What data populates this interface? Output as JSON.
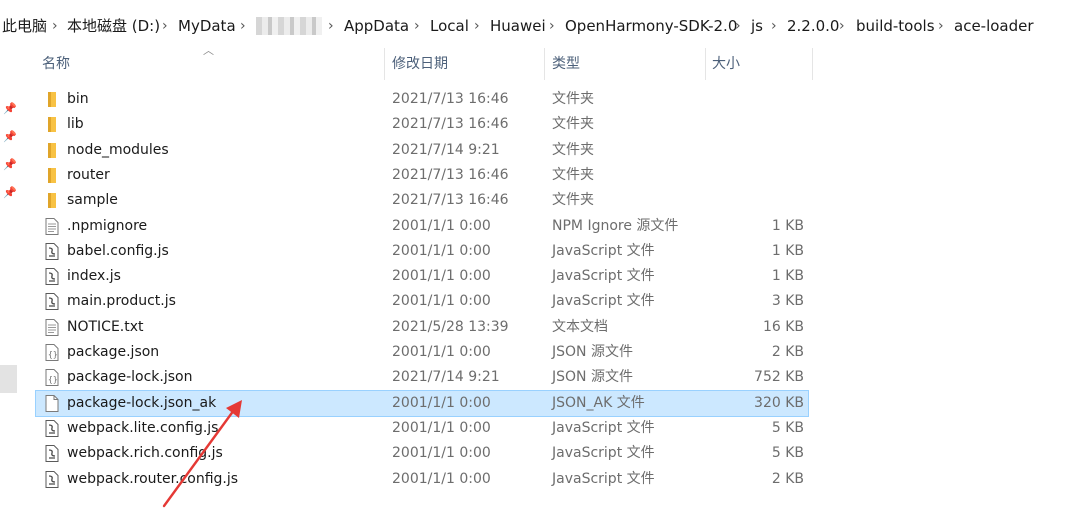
{
  "breadcrumb": {
    "items": [
      "此电脑",
      "本地磁盘 (D:)",
      "MyData",
      "AppData",
      "Local",
      "Huawei",
      "OpenHarmony-SDK-2.0",
      "js",
      "2.2.0.0",
      "build-tools",
      "ace-loader"
    ],
    "separator": "›"
  },
  "columns": {
    "name": "名称",
    "date": "修改日期",
    "type": "类型",
    "size": "大小"
  },
  "files": [
    {
      "name": "bin",
      "date": "2021/7/13 16:46",
      "type": "文件夹",
      "size": "",
      "icon": "folder-icon"
    },
    {
      "name": "lib",
      "date": "2021/7/13 16:46",
      "type": "文件夹",
      "size": "",
      "icon": "folder-icon"
    },
    {
      "name": "node_modules",
      "date": "2021/7/14 9:21",
      "type": "文件夹",
      "size": "",
      "icon": "folder-icon"
    },
    {
      "name": "router",
      "date": "2021/7/13 16:46",
      "type": "文件夹",
      "size": "",
      "icon": "folder-icon"
    },
    {
      "name": "sample",
      "date": "2021/7/13 16:46",
      "type": "文件夹",
      "size": "",
      "icon": "folder-icon"
    },
    {
      "name": ".npmignore",
      "date": "2001/1/1 0:00",
      "type": "NPM Ignore 源文件",
      "size": "1 KB",
      "icon": "text-file-icon"
    },
    {
      "name": "babel.config.js",
      "date": "2001/1/1 0:00",
      "type": "JavaScript 文件",
      "size": "1 KB",
      "icon": "script-file-icon"
    },
    {
      "name": "index.js",
      "date": "2001/1/1 0:00",
      "type": "JavaScript 文件",
      "size": "1 KB",
      "icon": "script-file-icon"
    },
    {
      "name": "main.product.js",
      "date": "2001/1/1 0:00",
      "type": "JavaScript 文件",
      "size": "3 KB",
      "icon": "script-file-icon"
    },
    {
      "name": "NOTICE.txt",
      "date": "2021/5/28 13:39",
      "type": "文本文档",
      "size": "16 KB",
      "icon": "text-file-icon"
    },
    {
      "name": "package.json",
      "date": "2001/1/1 0:00",
      "type": "JSON 源文件",
      "size": "2 KB",
      "icon": "json-file-icon"
    },
    {
      "name": "package-lock.json",
      "date": "2021/7/14 9:21",
      "type": "JSON 源文件",
      "size": "752 KB",
      "icon": "json-file-icon"
    },
    {
      "name": "package-lock.json_ak",
      "date": "2001/1/1 0:00",
      "type": "JSON_AK 文件",
      "size": "320 KB",
      "icon": "blank-file-icon",
      "selected": true
    },
    {
      "name": "webpack.lite.config.js",
      "date": "2001/1/1 0:00",
      "type": "JavaScript 文件",
      "size": "5 KB",
      "icon": "script-file-icon"
    },
    {
      "name": "webpack.rich.config.js",
      "date": "2001/1/1 0:00",
      "type": "JavaScript 文件",
      "size": "5 KB",
      "icon": "script-file-icon"
    },
    {
      "name": "webpack.router.config.js",
      "date": "2001/1/1 0:00",
      "type": "JavaScript 文件",
      "size": "2 KB",
      "icon": "script-file-icon"
    }
  ],
  "colors": {
    "selection": "#cce8ff",
    "selection_border": "#99d1ff",
    "folder": "#f8c244",
    "annotation_arrow": "#e53935"
  }
}
